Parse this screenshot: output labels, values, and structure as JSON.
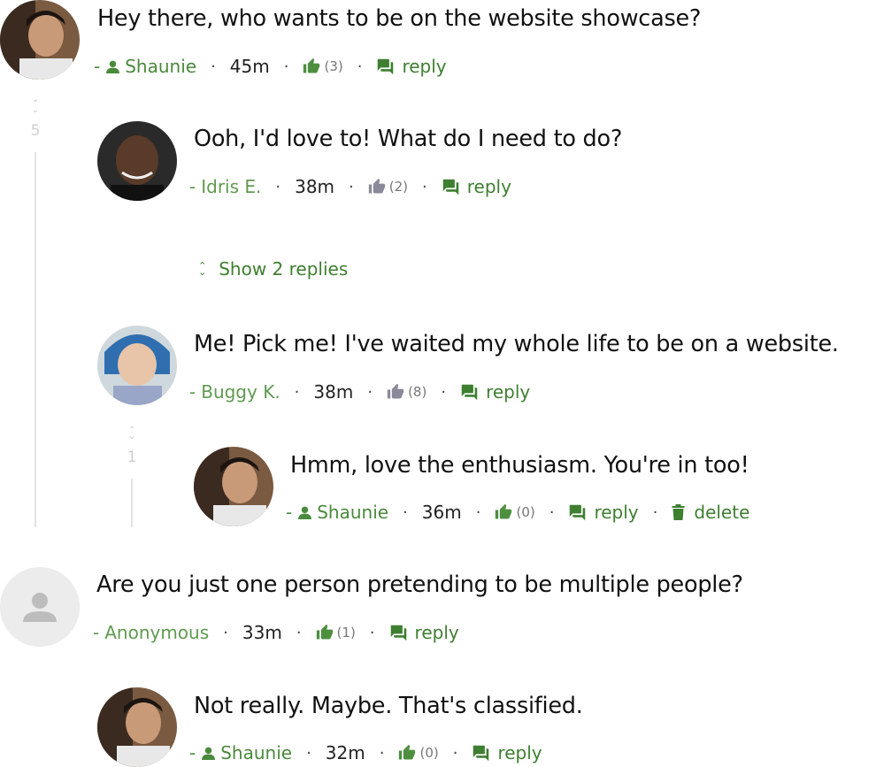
{
  "comments": [
    {
      "text": "Hey there, who wants to be on the website showcase?",
      "author": "Shaunie",
      "time": "45m",
      "likes": "(3)",
      "reply": "reply"
    },
    {
      "text": "Ooh, I'd love to! What do I need to do?",
      "author": "Idris E.",
      "time": "38m",
      "likes": "(2)",
      "reply": "reply"
    },
    {
      "text": "Me! Pick me! I've waited my whole life to be on a website.",
      "author": "Buggy K.",
      "time": "38m",
      "likes": "(8)",
      "reply": "reply"
    },
    {
      "text": "Hmm, love the enthusiasm. You're in too!",
      "author": "Shaunie",
      "time": "36m",
      "likes": "(0)",
      "reply": "reply",
      "delete": "delete"
    },
    {
      "text": "Are you just one person pretending to be multiple people?",
      "author": "Anonymous",
      "time": "33m",
      "likes": "(1)",
      "reply": "reply"
    },
    {
      "text": "Not really. Maybe. That's classified.",
      "author": "Shaunie",
      "time": "32m",
      "likes": "(0)",
      "reply": "reply"
    }
  ],
  "thread_counts": {
    "outer": "5",
    "inner": "1"
  },
  "show_replies": "Show 2 replies",
  "dash": "-",
  "separator": "·",
  "colors": {
    "link_green": "#3e7f30",
    "author_green": "#4a8a3c",
    "thread_line": "#e3e3e3"
  },
  "icons": {
    "author": "person-icon",
    "like": "thumbs-up-icon",
    "reply": "reply-bubble-icon",
    "delete": "trash-icon",
    "collapse": "collapse-chevrons-icon",
    "anonymous": "user-silhouette-icon"
  }
}
